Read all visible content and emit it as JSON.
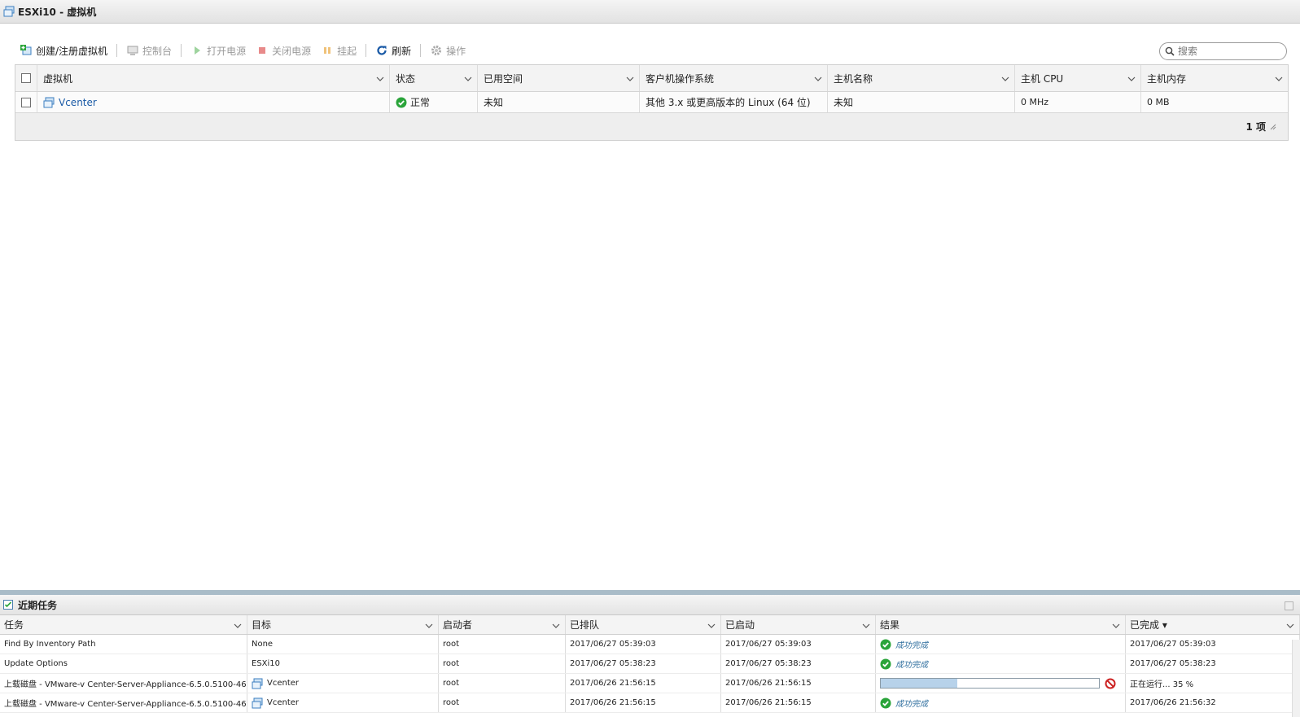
{
  "window": {
    "title": "ESXi10 - 虚拟机"
  },
  "toolbar": {
    "create_label": "创建/注册虚拟机",
    "console_label": "控制台",
    "power_on_label": "打开电源",
    "power_off_label": "关闭电源",
    "suspend_label": "挂起",
    "refresh_label": "刷新",
    "actions_label": "操作"
  },
  "search": {
    "placeholder": "搜索",
    "value": ""
  },
  "vm_table": {
    "columns": [
      "虚拟机",
      "状态",
      "已用空间",
      "客户机操作系统",
      "主机名称",
      "主机 CPU",
      "主机内存"
    ],
    "rows": [
      {
        "name": "Vcenter",
        "status": "正常",
        "used_space": "未知",
        "guest_os": "其他 3.x 或更高版本的 Linux (64 位)",
        "host_name": "未知",
        "host_cpu": "0 MHz",
        "host_mem": "0 MB"
      }
    ],
    "footer_count": "1 项"
  },
  "tasks_panel": {
    "title": "近期任务",
    "columns": [
      "任务",
      "目标",
      "启动者",
      "已排队",
      "已启动",
      "结果",
      "已完成 ▾"
    ],
    "rows": [
      {
        "task": "Find By Inventory Path",
        "target": "None",
        "initiator": "root",
        "queued": "2017/06/27 05:39:03",
        "started": "2017/06/27 05:39:03",
        "result": "成功完成",
        "completed": "2017/06/27 05:39:03"
      },
      {
        "task": "Update Options",
        "target": "ESXi10",
        "initiator": "root",
        "queued": "2017/06/27 05:38:23",
        "started": "2017/06/27 05:38:23",
        "result": "成功完成",
        "completed": "2017/06/27 05:38:23"
      },
      {
        "task": "上载磁盘 - VMware-v Center-Server-Appliance-6.5.0.5100-46...",
        "target": "Vcenter",
        "initiator": "root",
        "queued": "2017/06/26 21:56:15",
        "started": "2017/06/26 21:56:15",
        "progress": 0.35,
        "completed": "正在运行... 35 %"
      },
      {
        "task": "上载磁盘 - VMware-v Center-Server-Appliance-6.5.0.5100-46...",
        "target": "Vcenter",
        "initiator": "root",
        "queued": "2017/06/26 21:56:15",
        "started": "2017/06/26 21:56:15",
        "result": "成功完成",
        "completed": "2017/06/26 21:56:32"
      }
    ]
  },
  "colors": {
    "accent": "#1a5aa6",
    "success": "#2aa43a",
    "cancel": "#cc2222",
    "panel_border": "#a9bcc8"
  }
}
